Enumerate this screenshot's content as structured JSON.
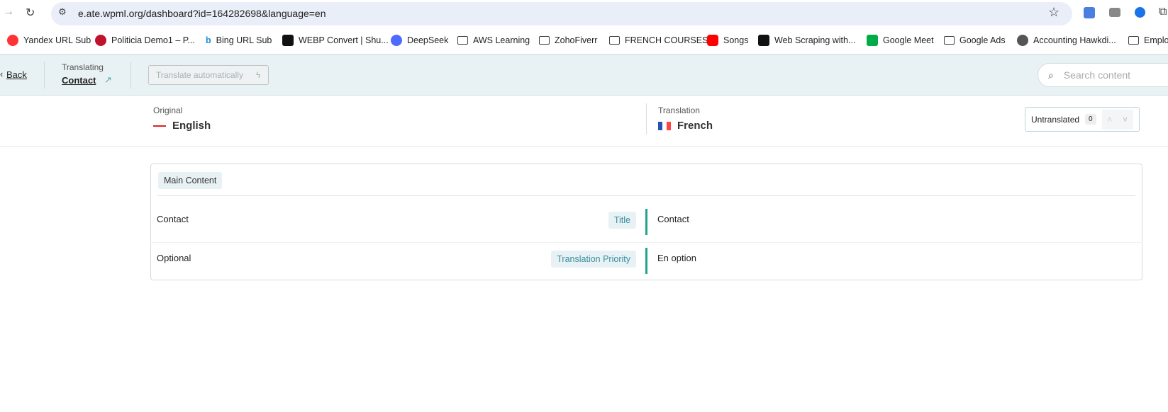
{
  "browser": {
    "url": "e.ate.wpml.org/dashboard?id=164282698&language=en",
    "bookmarks": [
      "Yandex URL Sub",
      "Politicia Demo1 – P...",
      "Bing URL Sub",
      "WEBP Convert | Shu...",
      "DeepSeek",
      "AWS Learning",
      "ZohoFiverr",
      "FRENCH COURSES",
      "Songs",
      "Web Scraping with...",
      "Google Meet",
      "Google Ads",
      "Accounting Hawkdi...",
      "Emplo"
    ]
  },
  "header": {
    "back": "Back",
    "translating_label": "Translating",
    "document": "Contact",
    "translate_auto": "Translate automatically",
    "search_placeholder": "Search content"
  },
  "languages": {
    "original_label": "Original",
    "original": "English",
    "translation_label": "Translation",
    "translation": "French",
    "filter": "Untranslated",
    "count": "0"
  },
  "section": {
    "title": "Main Content",
    "rows": [
      {
        "original": "Contact",
        "field": "Title",
        "translation": "Contact"
      },
      {
        "original": "Optional",
        "field": "Translation Priority",
        "translation": "En option"
      }
    ]
  },
  "colors": {
    "accent": "#22a38a",
    "header_bg": "#e8f1f3"
  }
}
